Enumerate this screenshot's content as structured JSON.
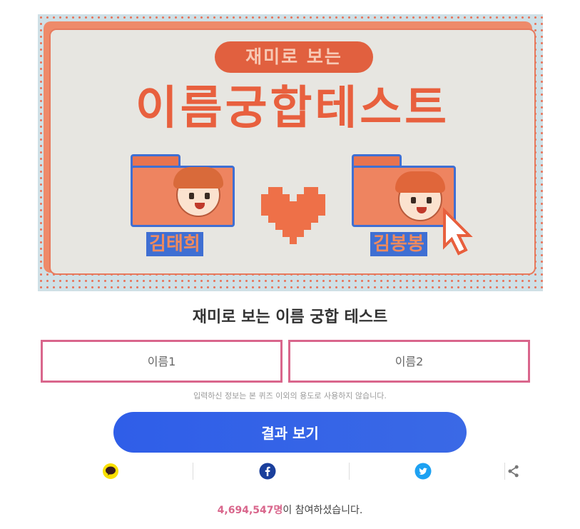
{
  "banner": {
    "pill_text": "재미로 보는",
    "title": "이름궁합테스트",
    "left_name": "김태희",
    "right_name": "김봉봉"
  },
  "page_title": "재미로 보는 이름 궁합 테스트",
  "inputs": {
    "name1_placeholder": "이름1",
    "name2_placeholder": "이름2"
  },
  "notice": "입력하신 정보는 본 퀴즈 이외의 용도로 사용하지 않습니다.",
  "result_button": "결과 보기",
  "share": [
    {
      "icon": "kakao-icon",
      "color": "#f9e000"
    },
    {
      "icon": "facebook-icon",
      "color": "#1a3f9c"
    },
    {
      "icon": "twitter-icon",
      "color": "#1da1f2"
    },
    {
      "icon": "share-icon",
      "color": "#777777"
    }
  ],
  "participants": {
    "count": "4,694,547명",
    "suffix": "이 참여하셨습니다."
  },
  "colors": {
    "accent_pink": "#d9668c",
    "button_blue": "#2f5ee8",
    "banner_orange": "#e8603e"
  }
}
